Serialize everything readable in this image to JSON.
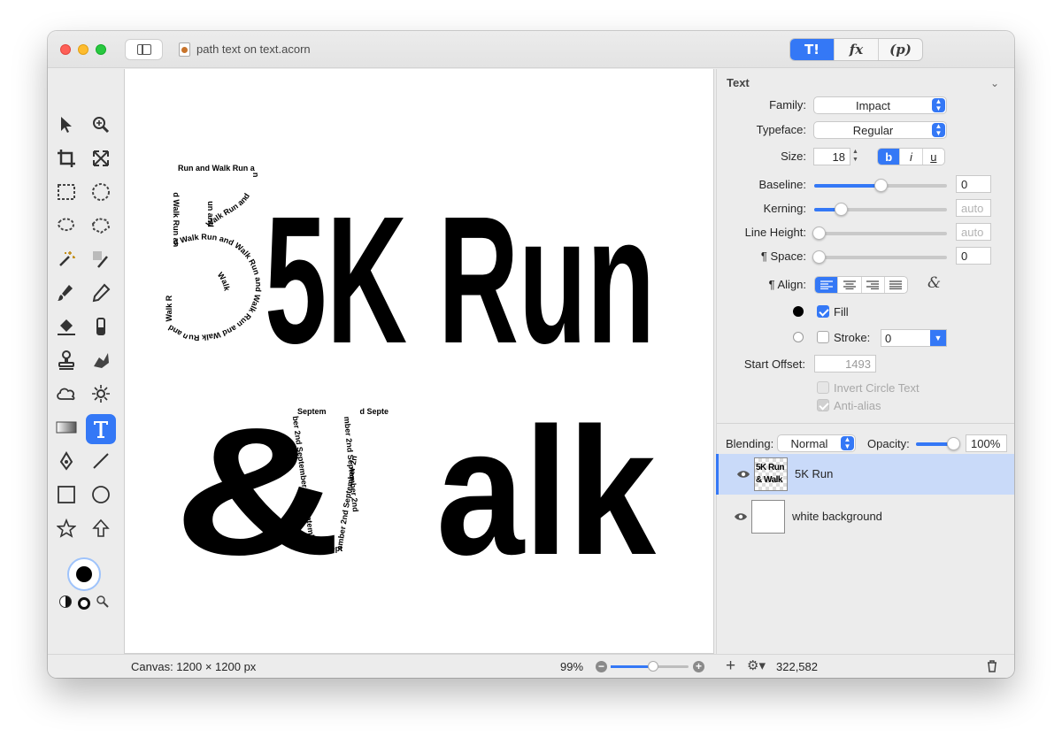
{
  "window": {
    "title": "path text on text.acorn"
  },
  "toolbar": {
    "segments": [
      "T!",
      "fx",
      "(p)"
    ]
  },
  "canvas": {
    "line1": "5K Run",
    "line2": "& Walk",
    "path_text_1": "Run and Walk Run and Walk Run and Walk Run and Walk Run and Walk Run and Walk Run and Walk Run and Walk Run and Walk",
    "path_text_2": "September 2nd September 2nd September 2nd September 2nd September 2nd September 2nd September 2nd"
  },
  "inspector": {
    "section": "Text",
    "family_label": "Family:",
    "family_value": "Impact",
    "typeface_label": "Typeface:",
    "typeface_value": "Regular",
    "size_label": "Size:",
    "size_value": "18",
    "style_bold": "b",
    "style_italic": "i",
    "style_underline": "u",
    "baseline_label": "Baseline:",
    "baseline_value": "0",
    "kerning_label": "Kerning:",
    "kerning_value": "auto",
    "lineheight_label": "Line Height:",
    "lineheight_value": "auto",
    "space_label": "¶ Space:",
    "space_value": "0",
    "align_label": "¶ Align:",
    "fill_label": "Fill",
    "stroke_label": "Stroke:",
    "stroke_value": "0",
    "start_offset_label": "Start Offset:",
    "start_offset_value": "1493",
    "invert_label": "Invert Circle Text",
    "antialias_label": "Anti-alias",
    "blending_label": "Blending:",
    "blending_value": "Normal",
    "opacity_label": "Opacity:",
    "opacity_value": "100%"
  },
  "sliders": {
    "baseline": 0.5,
    "kerning": 0.2,
    "lineheight": 0.0,
    "space": 0.0,
    "opacity": 1.0,
    "zoom": 0.55
  },
  "layers": [
    {
      "name": "5K Run",
      "thumb_line1": "5K Run",
      "thumb_line2": "& Walk",
      "selected": true
    },
    {
      "name": "white background",
      "selected": false
    }
  ],
  "status": {
    "canvas_size": "Canvas: 1200 × 1200 px",
    "zoom": "99%",
    "coords": "322,582"
  },
  "colors": {
    "accent": "#3478f6",
    "selection": "#c9daf9"
  }
}
